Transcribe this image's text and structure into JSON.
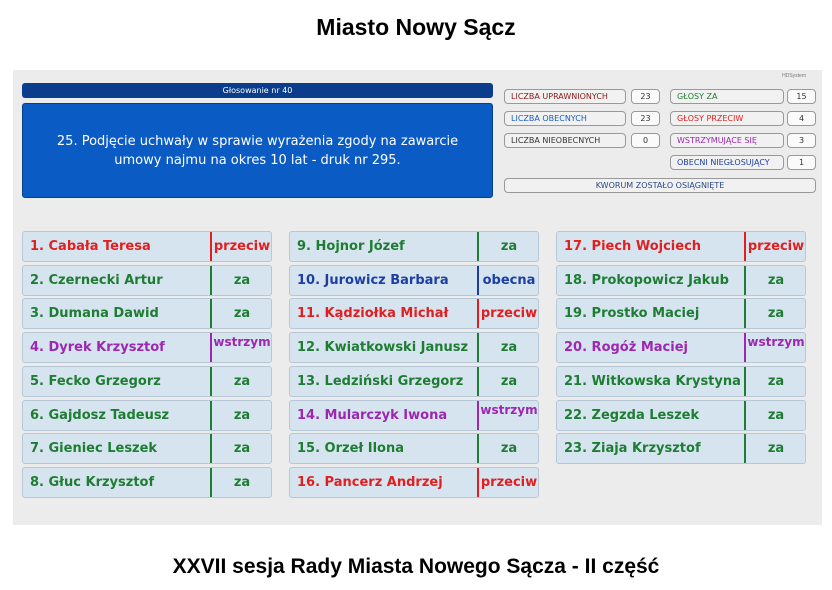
{
  "page_title": "Miasto Nowy Sącz",
  "bottom_title": "XXVII sesja Rady Miasta Nowego Sącza - II część",
  "system_mark": "HDSystem",
  "vote_header": "Głosowanie nr 40",
  "motion_text": "25. Podjęcie uchwały w sprawie wyrażenia zgody na zawarcie umowy najmu na okres 10 lat - druk nr 295.",
  "stats": {
    "uprawnionych": {
      "label": "LICZBA UPRAWNIONYCH",
      "value": "23",
      "color": "#8b1a1a"
    },
    "obecnych": {
      "label": "LICZBA OBECNYCH",
      "value": "23",
      "color": "#1d5fbf"
    },
    "nieobecnych": {
      "label": "LICZBA NIEOBECNYCH",
      "value": "0",
      "color": "#333333"
    },
    "za": {
      "label": "GŁOSY ZA",
      "value": "15",
      "color": "#1e7d32"
    },
    "przeciw": {
      "label": "GŁOSY PRZECIW",
      "value": "4",
      "color": "#e02020"
    },
    "wstrzymujace": {
      "label": "WSTRZYMUJĄCE SIĘ",
      "value": "3",
      "color": "#9c27b0"
    },
    "niegłosujacy": {
      "label": "OBECNI NIEGŁOSUJĄCY",
      "value": "1",
      "color": "#1d3fa3"
    }
  },
  "quorum_text": "KWORUM ZOSTAŁO OSIĄGNIĘTE",
  "councillors": [
    {
      "name": "1. Cabała Teresa",
      "status": "przeciw",
      "color": "#e02020"
    },
    {
      "name": "2. Czernecki Artur",
      "status": "za",
      "color": "#1e7d32"
    },
    {
      "name": "3. Dumana Dawid",
      "status": "za",
      "color": "#1e7d32"
    },
    {
      "name": "4. Dyrek Krzysztof",
      "status": "wstrzym",
      "color": "#9c27b0"
    },
    {
      "name": "5. Fecko Grzegorz",
      "status": "za",
      "color": "#1e7d32"
    },
    {
      "name": "6. Gajdosz Tadeusz",
      "status": "za",
      "color": "#1e7d32"
    },
    {
      "name": "7. Gieniec Leszek",
      "status": "za",
      "color": "#1e7d32"
    },
    {
      "name": "8. Głuc Krzysztof",
      "status": "za",
      "color": "#1e7d32"
    },
    {
      "name": "9. Hojnor Józef",
      "status": "za",
      "color": "#1e7d32"
    },
    {
      "name": "10. Jurowicz Barbara",
      "status": "obecna",
      "color": "#1d3fa3"
    },
    {
      "name": "11. Kądziołka Michał",
      "status": "przeciw",
      "color": "#e02020"
    },
    {
      "name": "12. Kwiatkowski Janusz",
      "status": "za",
      "color": "#1e7d32"
    },
    {
      "name": "13. Ledziński Grzegorz",
      "status": "za",
      "color": "#1e7d32"
    },
    {
      "name": "14. Mularczyk Iwona",
      "status": "wstrzym",
      "color": "#9c27b0"
    },
    {
      "name": "15. Orzeł Ilona",
      "status": "za",
      "color": "#1e7d32"
    },
    {
      "name": "16. Pancerz Andrzej",
      "status": "przeciw",
      "color": "#e02020"
    },
    {
      "name": "17. Piech Wojciech",
      "status": "przeciw",
      "color": "#e02020"
    },
    {
      "name": "18. Prokopowicz Jakub",
      "status": "za",
      "color": "#1e7d32"
    },
    {
      "name": "19. Prostko Maciej",
      "status": "za",
      "color": "#1e7d32"
    },
    {
      "name": "20. Rogóż Maciej",
      "status": "wstrzym",
      "color": "#9c27b0"
    },
    {
      "name": "21. Witkowska Krystyna",
      "status": "za",
      "color": "#1e7d32"
    },
    {
      "name": "22. Zegzda Leszek",
      "status": "za",
      "color": "#1e7d32"
    },
    {
      "name": "23. Ziaja Krzysztof",
      "status": "za",
      "color": "#1e7d32"
    }
  ]
}
